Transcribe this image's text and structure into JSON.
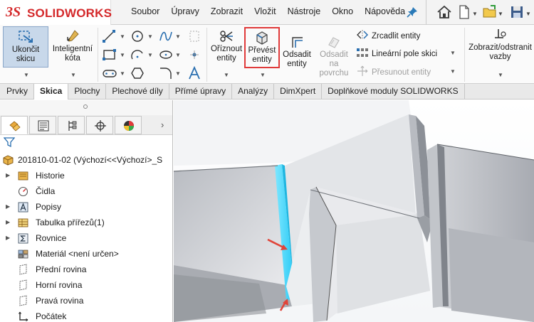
{
  "app": {
    "logo_mark": "3S",
    "logo_text": "SOLIDWORKS"
  },
  "menu": [
    "Soubor",
    "Úpravy",
    "Zobrazit",
    "Vložit",
    "Nástroje",
    "Okno",
    "Nápověda"
  ],
  "ribbon": {
    "exit_sketch": "Ukončit skicu",
    "smart_dimension": "Inteligentní kóta",
    "trim": "Oříznout entity",
    "convert": "Převést entity",
    "offset": "Odsadit entity",
    "offset_surface": "Odsadit na povrchu",
    "mirror": "Zrcadlit entity",
    "linear_pattern": "Lineární pole skici",
    "move": "Přesunout entity",
    "relations": "Zobrazit/odstranit vazby",
    "highlight_color": "#e03a3a"
  },
  "tabs": [
    {
      "label": "Prvky",
      "active": false
    },
    {
      "label": "Skica",
      "active": true
    },
    {
      "label": "Plochy",
      "active": false
    },
    {
      "label": "Plechové díly",
      "active": false
    },
    {
      "label": "Přímé úpravy",
      "active": false
    },
    {
      "label": "Analýzy",
      "active": false
    },
    {
      "label": "DimXpert",
      "active": false
    },
    {
      "label": "Doplňkové moduly SOLIDWORKS",
      "active": false
    }
  ],
  "tree": {
    "root": "201810-01-02  (Výchozí<<Výchozí>_S",
    "items": [
      {
        "label": "Historie",
        "icon": "history-icon",
        "expandable": true
      },
      {
        "label": "Čidla",
        "icon": "sensors-icon",
        "expandable": false
      },
      {
        "label": "Popisy",
        "icon": "annotations-icon",
        "expandable": true
      },
      {
        "label": "Tabulka přířezů(1)",
        "icon": "cut-list-icon",
        "expandable": true
      },
      {
        "label": "Rovnice",
        "icon": "equations-icon",
        "expandable": true
      },
      {
        "label": "Materiál <není určen>",
        "icon": "material-icon",
        "expandable": false
      },
      {
        "label": "Přední rovina",
        "icon": "plane-icon",
        "expandable": false
      },
      {
        "label": "Horní rovina",
        "icon": "plane-icon",
        "expandable": false
      },
      {
        "label": "Pravá rovina",
        "icon": "plane-icon",
        "expandable": false
      },
      {
        "label": "Počátek",
        "icon": "origin-icon",
        "expandable": false
      }
    ]
  },
  "colors": {
    "selected_edge": "#33d6ff",
    "accent_red": "#d4282a",
    "annotation_arrow": "#e0453a"
  }
}
